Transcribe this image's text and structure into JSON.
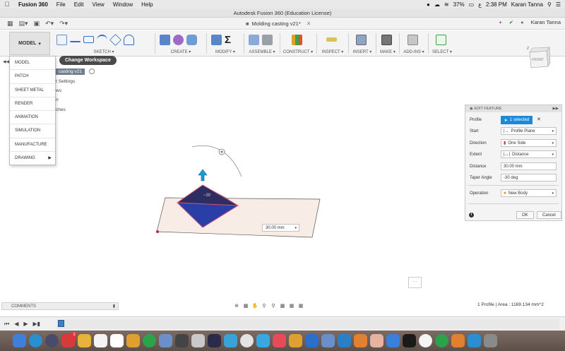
{
  "menubar": {
    "app_name": "Fusion 360",
    "items": [
      "File",
      "Edit",
      "View",
      "Window",
      "Help"
    ],
    "battery": "37%",
    "time": "2:38 PM",
    "user": "Karan Tanna"
  },
  "window": {
    "title": "Autodesk Fusion 360 (Education License)"
  },
  "appbar": {
    "doc_tab": "Molding casting v21*",
    "user": "Karan Tanna"
  },
  "ribbon": {
    "workspace": "MODEL",
    "groups": [
      "SKETCH",
      "CREATE",
      "MODIFY",
      "ASSEMBLE",
      "CONSTRUCT",
      "INSPECT",
      "INSERT",
      "MAKE",
      "ADD-INS",
      "SELECT"
    ]
  },
  "workspace_menu": {
    "items": [
      "MODEL",
      "PATCH",
      "SHEET METAL",
      "RENDER",
      "ANIMATION",
      "SIMULATION",
      "MANUFACTURE",
      "DRAWING"
    ],
    "tooltip": "Change Workspace"
  },
  "browser": {
    "root": "casting v21",
    "rows": [
      "t Settings",
      "ws",
      "n",
      "ches"
    ]
  },
  "viewcube": {
    "face": "FRONT",
    "axis": "Z"
  },
  "canvas": {
    "tag_label": "30.00 mm"
  },
  "edit_feature": {
    "header": "EDIT FEATURE",
    "fields": [
      {
        "label": "Profile",
        "value": "1 selected"
      },
      {
        "label": "Start",
        "value": "Profile Plane"
      },
      {
        "label": "Direction",
        "value": "One Side"
      },
      {
        "label": "Extent",
        "value": "Distance"
      },
      {
        "label": "Distance",
        "value": "30.00 mm"
      },
      {
        "label": "Taper Angle",
        "value": "-30 deg"
      },
      {
        "label": "Operation",
        "value": "New Body"
      }
    ],
    "ok": "OK",
    "cancel": "Cancel"
  },
  "bottom": {
    "comments": "COMMENTS",
    "status": "1 Profile | Area : 1169.134 mm^2"
  },
  "dock": {
    "badge_count": "3"
  },
  "colors": {
    "accent": "#1c8ad8",
    "profile_fill": "#2a3ea8",
    "profile_dark": "#2b2d63",
    "plane": "#f8ece6"
  }
}
